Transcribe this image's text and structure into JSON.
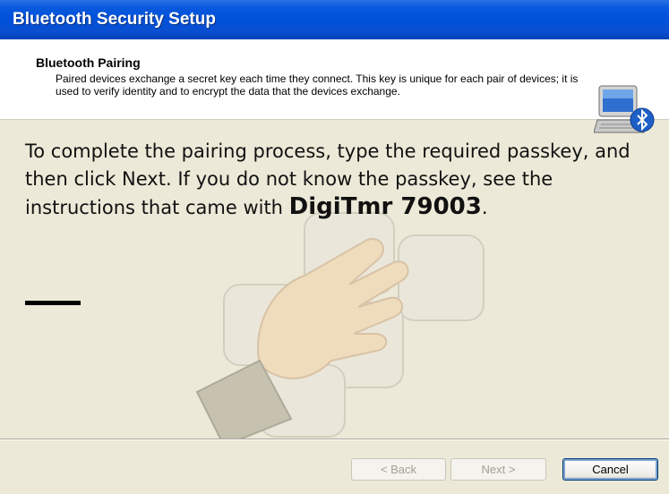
{
  "window": {
    "title": "Bluetooth Security Setup"
  },
  "header": {
    "title": "Bluetooth Pairing",
    "description": "Paired devices exchange a secret key each time they connect. This key is unique for each pair of devices; it is used to verify identity and to encrypt the data that the devices exchange.",
    "icon": "bluetooth-computer-icon"
  },
  "content": {
    "instruction_text": "To complete the pairing process, type the required passkey, and then click Next. If you do not know the passkey, see the instructions that came with ",
    "device_name": "DigiTmr 79003",
    "period": "."
  },
  "buttons": {
    "back": "< Back",
    "next": "Next >",
    "cancel": "Cancel"
  },
  "colors": {
    "titlebar": "#0a5ae0",
    "background": "#ece9d8",
    "header_background": "#ffffff"
  }
}
